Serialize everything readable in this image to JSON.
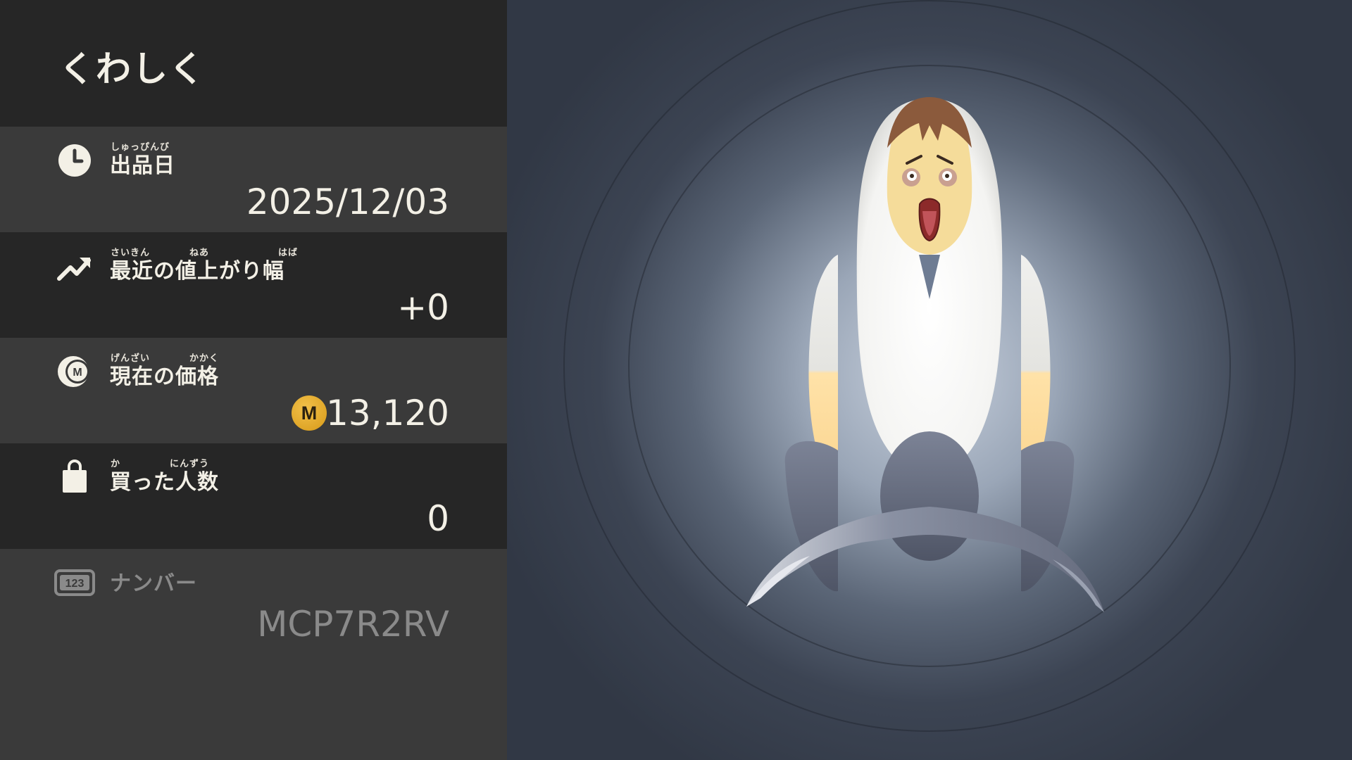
{
  "header": {
    "title": "くわしく"
  },
  "rows": [
    {
      "icon": "clock-icon",
      "ruby": "しゅっぴんび",
      "label": "出品日",
      "value": "2025/12/03"
    },
    {
      "icon": "trend-up-icon",
      "ruby": "さいきん　　　　ねあ　　　　　　　はば",
      "label": "最近の値上がり幅",
      "value": "+0"
    },
    {
      "icon": "m-coin-icon",
      "ruby": "げんざい　　　　かかく",
      "label": "現在の価格",
      "value": "13,120",
      "coin_letter": "M"
    },
    {
      "icon": "shopping-bag-icon",
      "ruby": "か　　　　　にんずう",
      "label": "買った人数",
      "value": "0"
    },
    {
      "icon": "number-badge-icon",
      "icon_text": "123",
      "label": "ナンバー",
      "value": "MCP7R2RV"
    }
  ],
  "colors": {
    "coin": "#d9a022",
    "panel_dark": "#262626",
    "panel_light": "#3a3a3a",
    "text": "#f3f0e6",
    "disabled_text": "#8a8a8a"
  }
}
